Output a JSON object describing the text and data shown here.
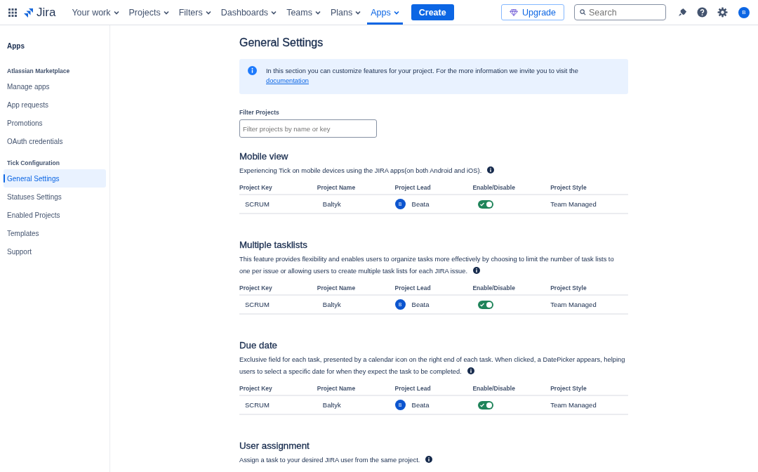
{
  "topbar": {
    "product": "Jira",
    "nav": [
      {
        "label": "Your work",
        "selected": false
      },
      {
        "label": "Projects",
        "selected": false
      },
      {
        "label": "Filters",
        "selected": false
      },
      {
        "label": "Dashboards",
        "selected": false
      },
      {
        "label": "Teams",
        "selected": false
      },
      {
        "label": "Plans",
        "selected": false
      },
      {
        "label": "Apps",
        "selected": true
      }
    ],
    "create": "Create",
    "upgrade": "Upgrade",
    "search": {
      "placeholder": "Search"
    },
    "avatar": "B"
  },
  "sidebar": {
    "title": "Apps",
    "groups": [
      {
        "heading": "Atlassian Marketplace",
        "items": [
          {
            "label": "Manage apps",
            "selected": false
          },
          {
            "label": "App requests",
            "selected": false
          },
          {
            "label": "Promotions",
            "selected": false
          },
          {
            "label": "OAuth credentials",
            "selected": false
          }
        ]
      },
      {
        "heading": "Tick Configuration",
        "items": [
          {
            "label": "General Settings",
            "selected": true
          },
          {
            "label": "Statuses Settings",
            "selected": false
          },
          {
            "label": "Enabled Projects",
            "selected": false
          },
          {
            "label": "Templates",
            "selected": false
          },
          {
            "label": "Support",
            "selected": false
          }
        ]
      }
    ]
  },
  "page": {
    "title": "General Settings",
    "info": {
      "text": "In this section you can customize features for your project. For the more information we invite you to visit the",
      "link": "documentation"
    },
    "filter": {
      "label": "Filter Projects",
      "placeholder": "Filter projects by name or key"
    },
    "sections": [
      {
        "title": "Mobile view",
        "description_lines": [
          "Experiencing Tick on mobile devices using the JIRA apps(on both Android and iOS)."
        ],
        "columns": [
          "Project Key",
          "Project Name",
          "Project Lead",
          "Enable/Disable",
          "Project Style"
        ],
        "rows": [
          {
            "key": "SCRUM",
            "name": "Baltyk",
            "lead_initial": "B",
            "lead": "Beata",
            "on": true,
            "style": "Team Managed"
          }
        ]
      },
      {
        "title": "Multiple tasklists",
        "description_lines": [
          "This feature provides flexibility and enables users to organize tasks more effectively by choosing to limit the number of task lists to",
          "one per issue or allowing users to create multiple task lists for each JIRA issue."
        ],
        "columns": [
          "Project Key",
          "Project Name",
          "Project Lead",
          "Enable/Disable",
          "Project Style"
        ],
        "rows": [
          {
            "key": "SCRUM",
            "name": "Baltyk",
            "lead_initial": "B",
            "lead": "Beata",
            "on": true,
            "style": "Team Managed"
          }
        ]
      },
      {
        "title": "Due date",
        "description_lines": [
          "Exclusive field for each task, presented by a calendar icon on the right end of each task. When clicked, a DatePicker appears, helping",
          "users to select a specific date for when they expect the task to be completed."
        ],
        "columns": [
          "Project Key",
          "Project Name",
          "Project Lead",
          "Enable/Disable",
          "Project Style"
        ],
        "rows": [
          {
            "key": "SCRUM",
            "name": "Baltyk",
            "lead_initial": "B",
            "lead": "Beata",
            "on": true,
            "style": "Team Managed"
          }
        ]
      },
      {
        "title": "User assignment",
        "description_lines": [
          "Assign a task to your desired JIRA user from the same project."
        ]
      }
    ]
  }
}
